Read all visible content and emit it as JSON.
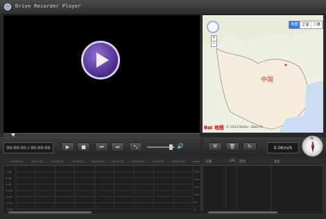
{
  "window": {
    "title": "Drive Recorder Player"
  },
  "player": {
    "time_display": "00:00:00 / 00:00:00",
    "buttons": [
      "play-icon",
      "stop-icon",
      "prev-icon",
      "next-icon",
      "fullscreen-icon"
    ],
    "volume_fraction": 0.85
  },
  "map": {
    "type_options": [
      "地图",
      "卫星",
      "三维"
    ],
    "selected_type": "地图",
    "country_label": "中国",
    "logo": "Bai 地图",
    "copyright": "© 2013 Baidu - Data ©"
  },
  "info": {
    "speed": "0.0Km/h",
    "compass_north": "N"
  },
  "graph": {
    "x_ticks": [
      "00:00:00",
      "00:00:05",
      "00:00:10",
      "00:00:15",
      "00:00:20",
      "00:00:25",
      "00:00:30",
      "00:00:35",
      "00:00:40",
      "Km/h"
    ],
    "y_ticks_left": [
      "1.0g",
      "0.5g",
      "0.0g",
      "-0.5g",
      "-1.0g",
      "-1.5g",
      "-2.0g"
    ],
    "y_ticks_right": [
      "250",
      "200",
      "150",
      "100",
      "50",
      "0"
    ]
  },
  "table": {
    "headers": [
      "日期",
      "GPS",
      "时间",
      "坐标"
    ]
  }
}
